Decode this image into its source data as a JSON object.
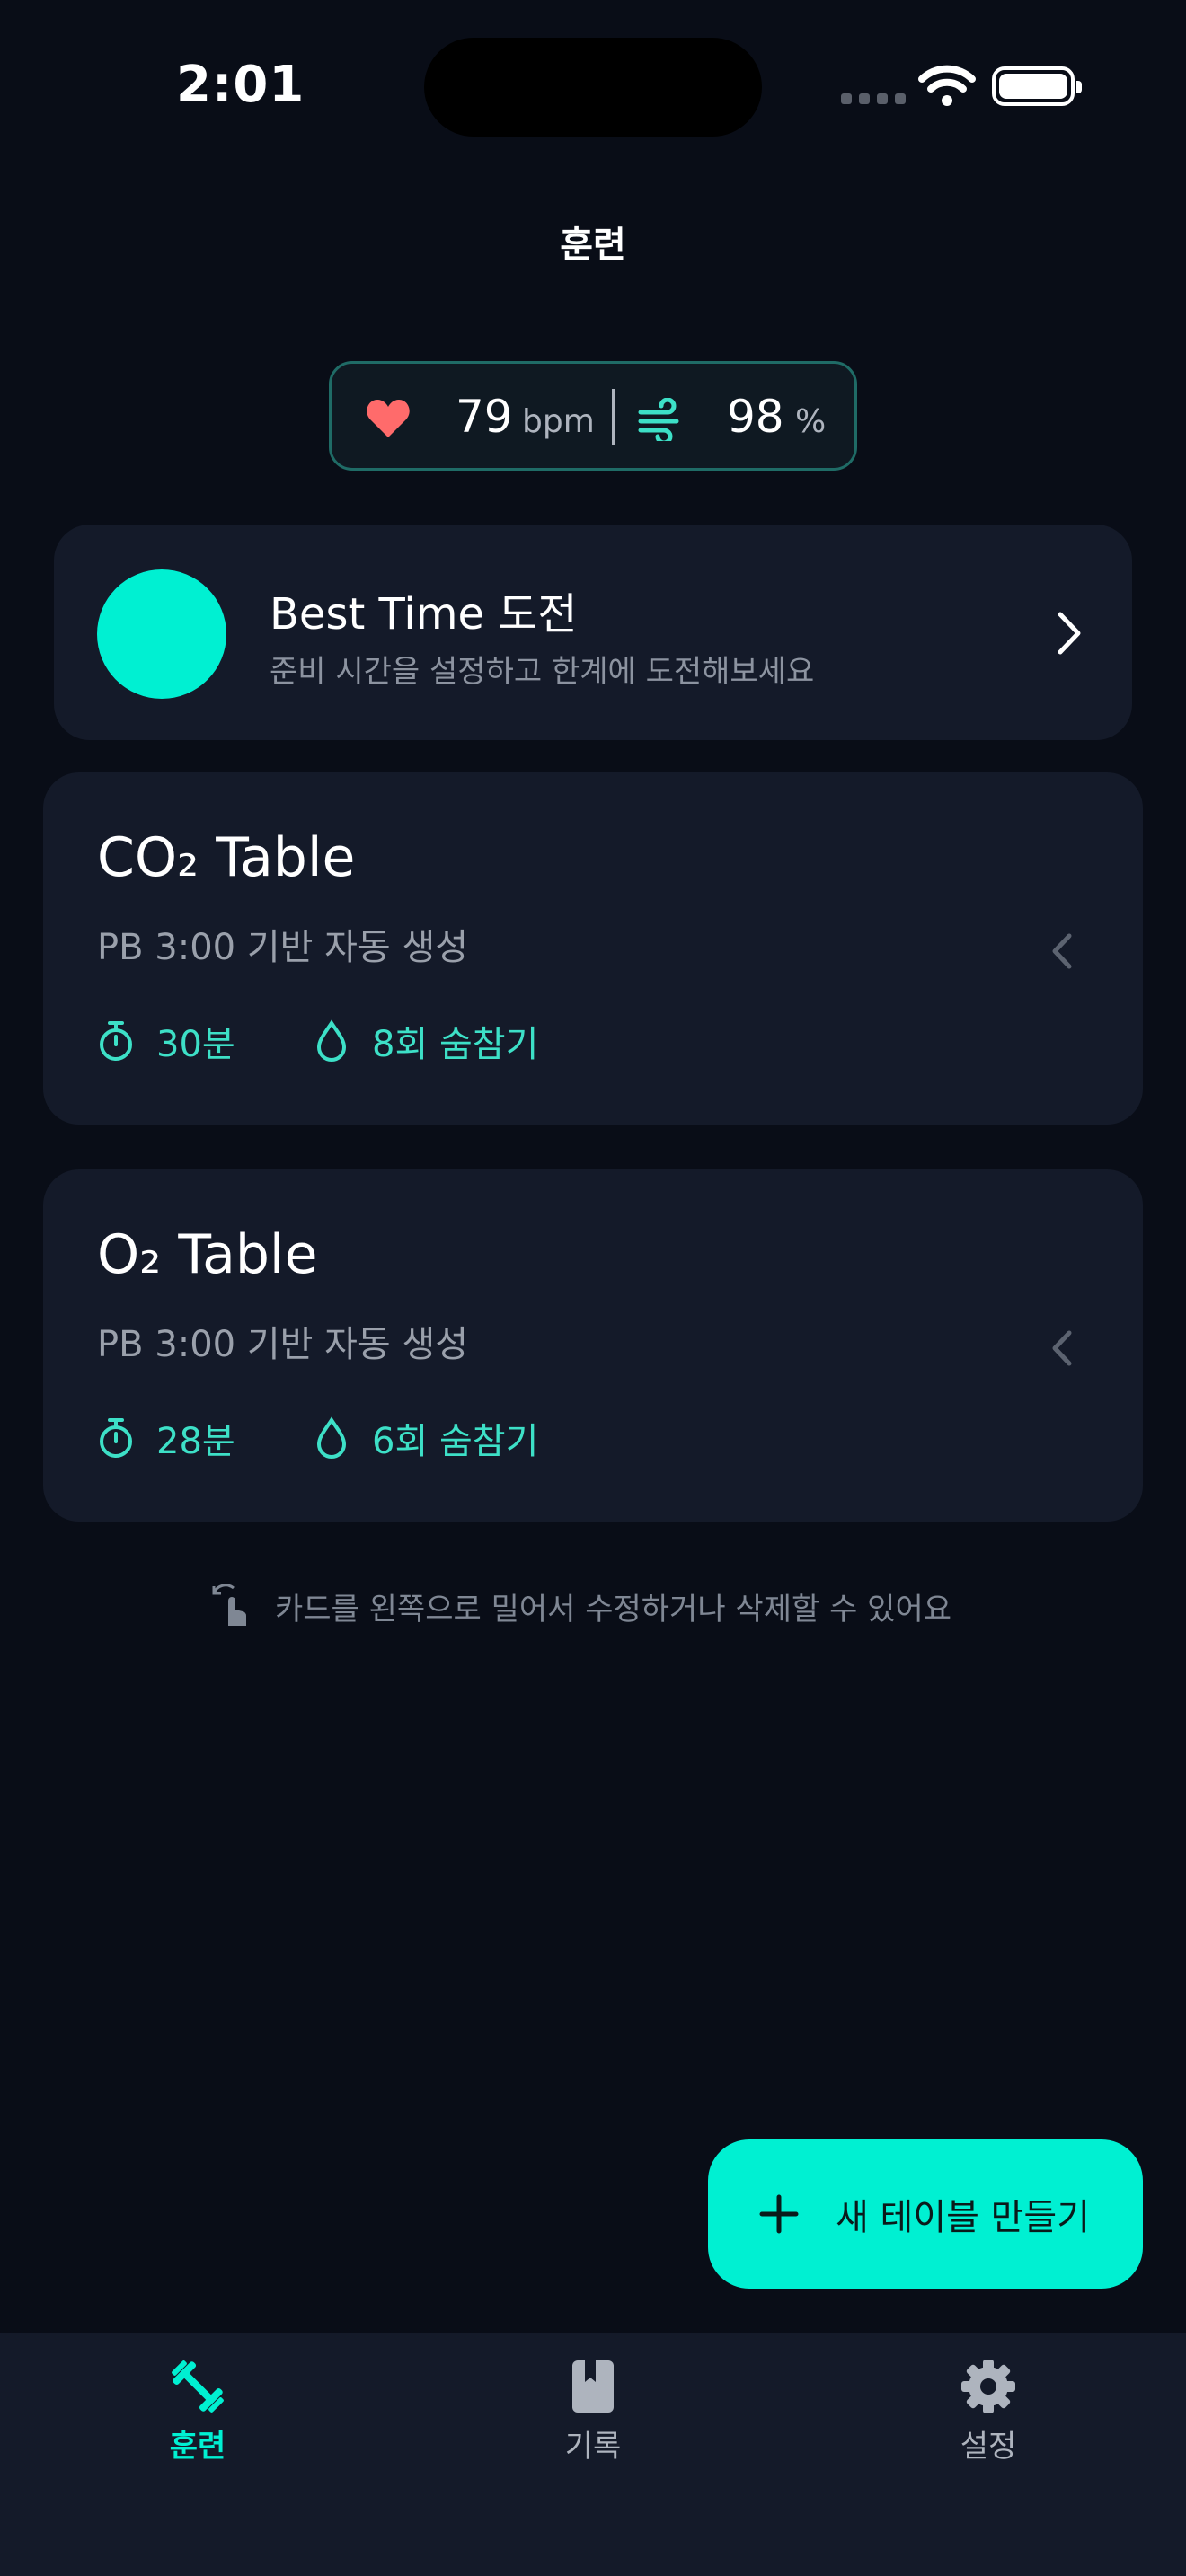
{
  "status": {
    "time": "2:01"
  },
  "header": {
    "title": "훈련"
  },
  "vitals": {
    "heart_rate": "79",
    "heart_rate_unit": "bpm",
    "spo2": "98",
    "spo2_unit": "%"
  },
  "best_time": {
    "title": "Best Time 도전",
    "subtitle": "준비 시간을 설정하고 한계에 도전해보세요"
  },
  "tables": [
    {
      "title": "CO₂ Table",
      "subtitle": "PB 3:00 기반 자동 생성",
      "duration": "30분",
      "holds": "8회 숨참기"
    },
    {
      "title": "O₂ Table",
      "subtitle": "PB 3:00 기반 자동 생성",
      "duration": "28분",
      "holds": "6회 숨참기"
    }
  ],
  "hint": "카드를 왼쪽으로 밀어서 수정하거나 삭제할 수 있어요",
  "fab": {
    "label": "새 테이블 만들기"
  },
  "tabs": [
    {
      "label": "훈련",
      "icon": "dumbbell-icon"
    },
    {
      "label": "기록",
      "icon": "bookmark-book-icon"
    },
    {
      "label": "설정",
      "icon": "gear-icon"
    }
  ],
  "colors": {
    "accent": "#00f0d2",
    "background": "#090d17",
    "card": "#141a29",
    "heart": "#ff6b6b"
  }
}
